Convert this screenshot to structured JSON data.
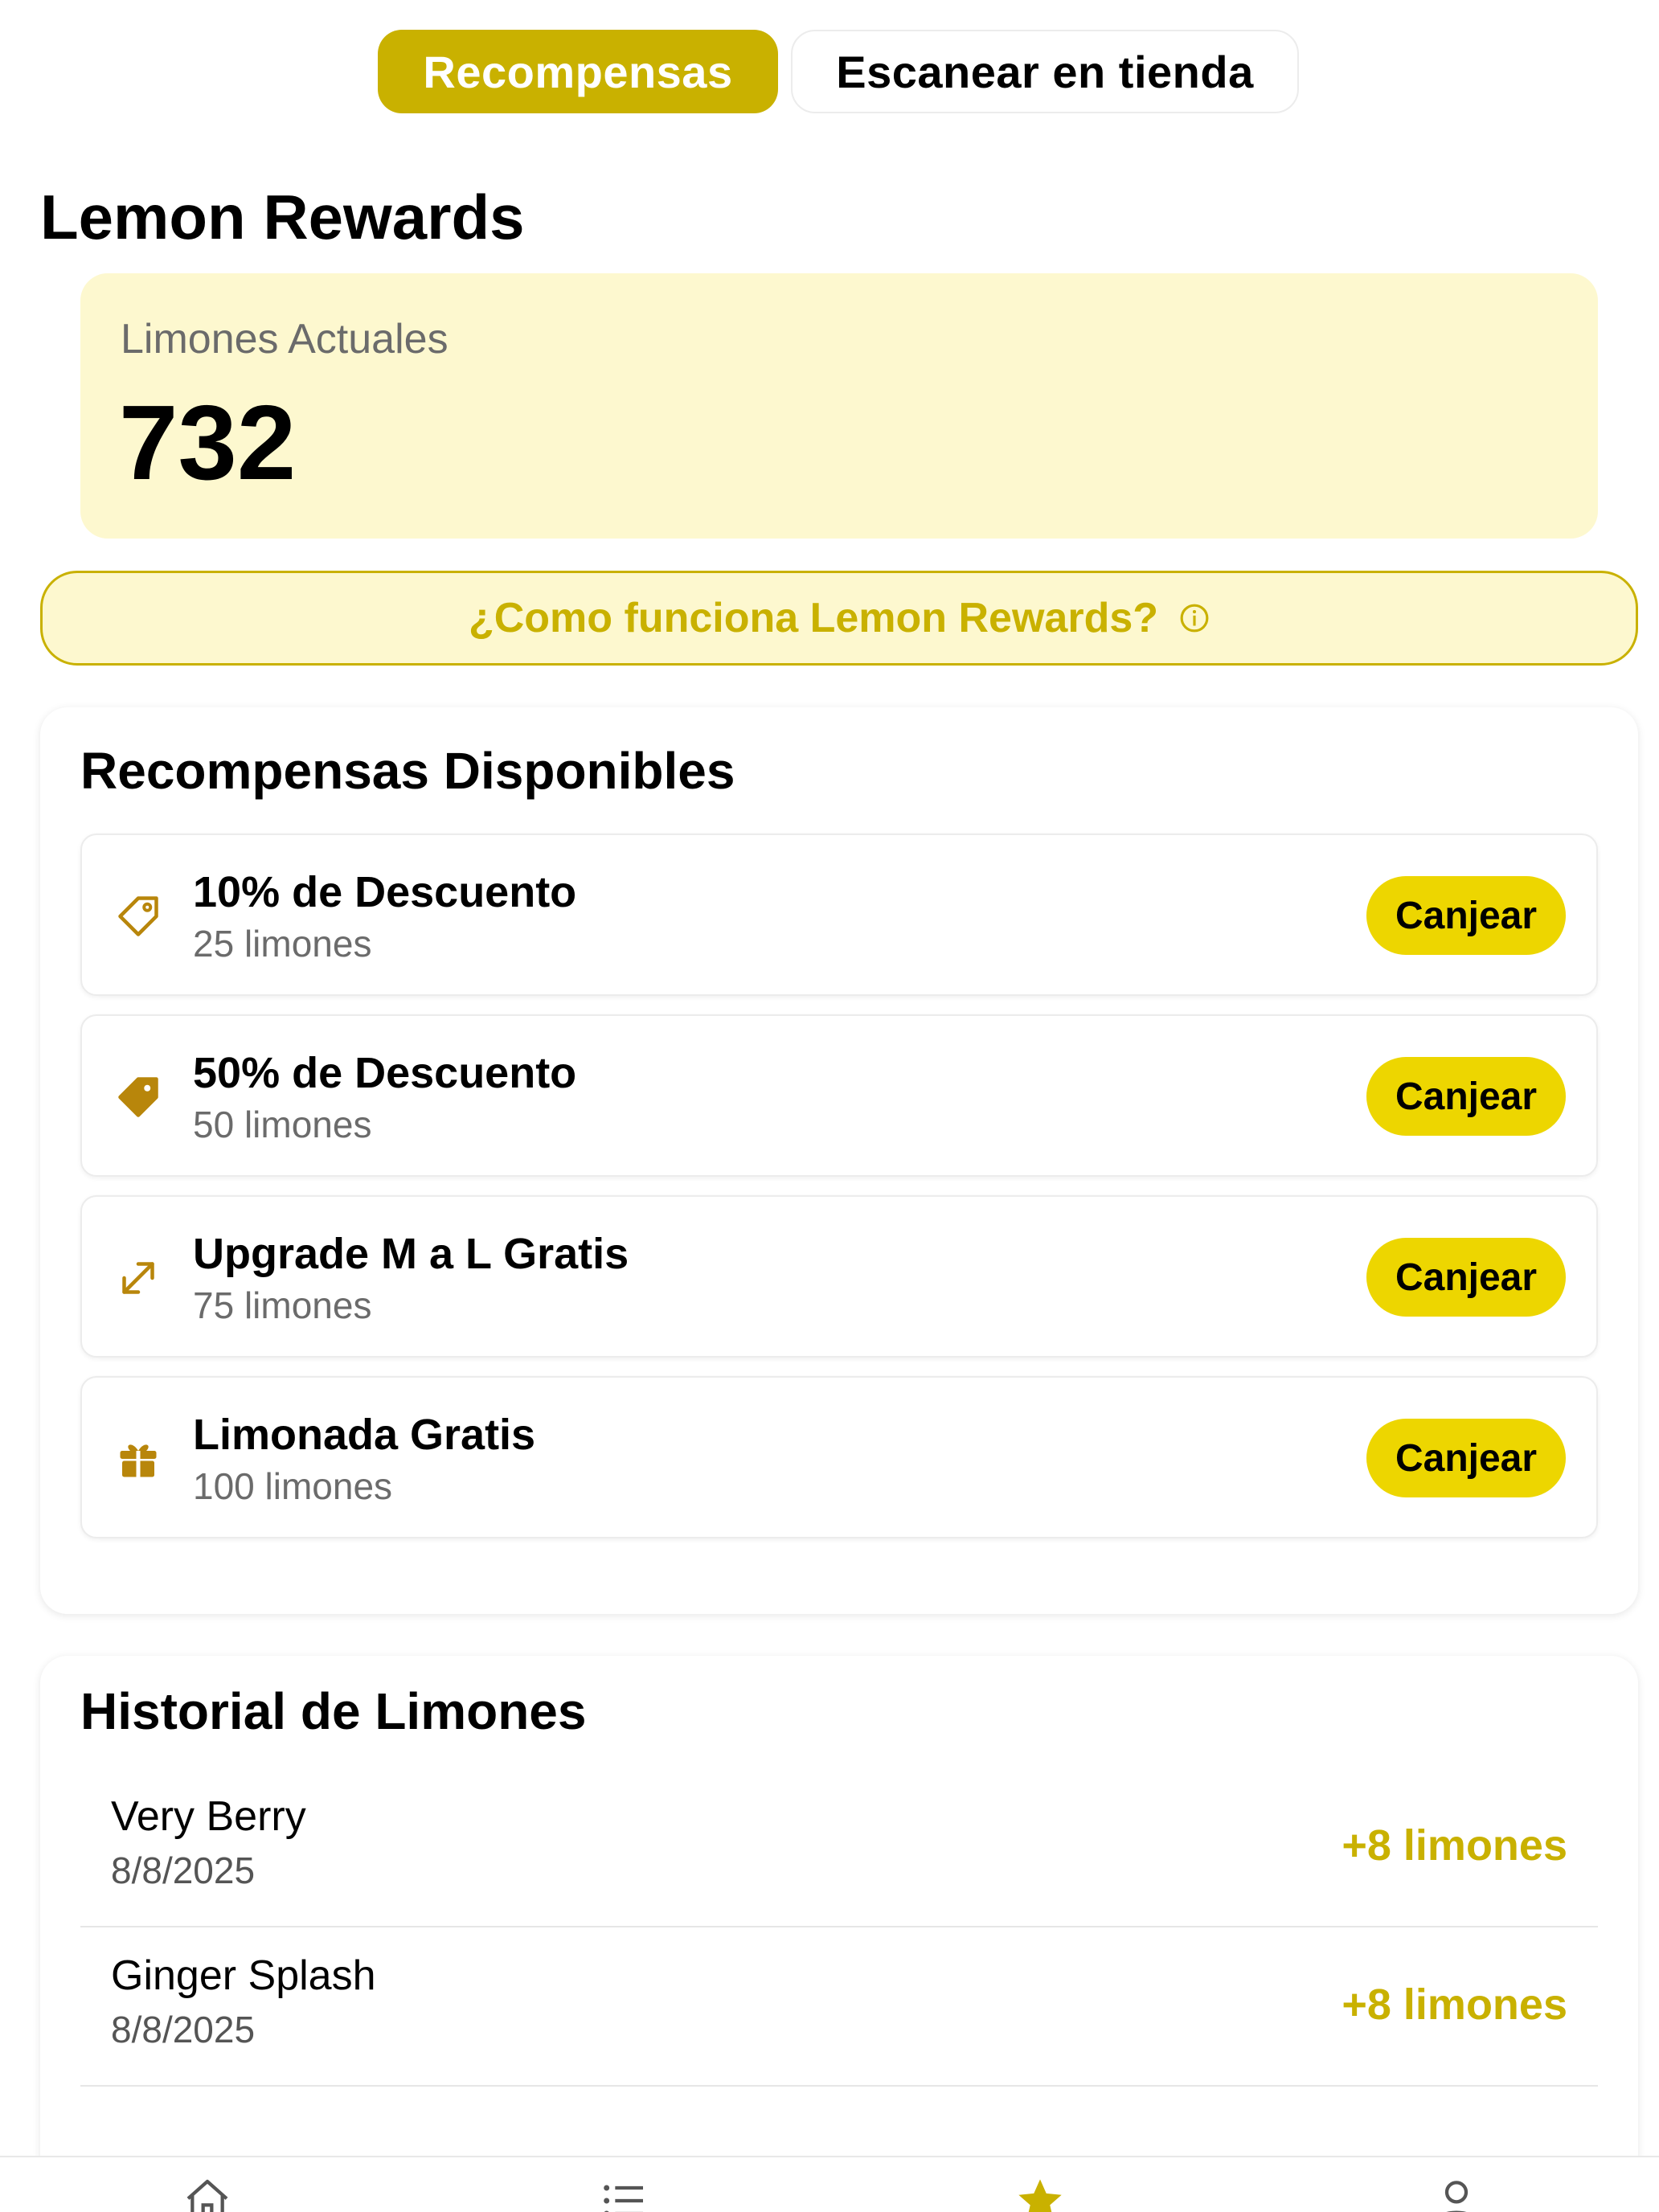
{
  "segmented": {
    "active_label": "Recompensas",
    "inactive_label": "Escanear en tienda"
  },
  "page_title": "Lemon Rewards",
  "balance": {
    "label": "Limones Actuales",
    "value": "732"
  },
  "how_it_works": {
    "label": "¿Como funciona Lemon Rewards?",
    "icon": "info-icon"
  },
  "rewards": {
    "title": "Recompensas Disponibles",
    "redeem_label": "Canjear",
    "items": [
      {
        "name": "10% de Descuento",
        "cost": "25 limones",
        "icon": "tag-outline-icon"
      },
      {
        "name": "50% de Descuento",
        "cost": "50 limones",
        "icon": "tag-filled-icon"
      },
      {
        "name": "Upgrade M a L Gratis",
        "cost": "75 limones",
        "icon": "expand-arrows-icon"
      },
      {
        "name": "Limonada Gratis",
        "cost": "100 limones",
        "icon": "gift-icon"
      }
    ]
  },
  "history": {
    "title": "Historial de Limones",
    "items": [
      {
        "name": "Very Berry",
        "date": "8/8/2025",
        "points": "+8 limones"
      },
      {
        "name": "Ginger Splash",
        "date": "8/8/2025",
        "points": "+8 limones"
      }
    ]
  },
  "tabbar": {
    "tabs": [
      "home-icon",
      "list-icon",
      "star-icon",
      "profile-icon"
    ],
    "active": "star-icon"
  },
  "colors": {
    "accent": "#c9b100",
    "button_yellow": "#edd600",
    "card_bg": "#fdf8cf",
    "icon_gold": "#b8860b"
  }
}
